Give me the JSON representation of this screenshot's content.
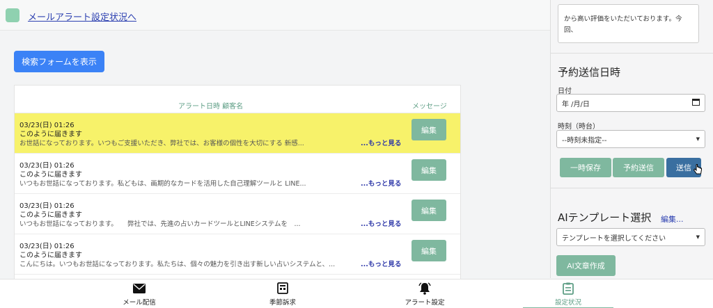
{
  "header": {
    "link_text": "メールアラート設定状況へ"
  },
  "search": {
    "button_label": "検索フォームを表示"
  },
  "table": {
    "col_alert": "アラート日時 顧客名",
    "col_message": "メッセージ",
    "more_label": "...もっと見る",
    "edit_label": "編集",
    "rows": [
      {
        "datetime": "03/23(日) 01:26",
        "subject": "このように届きます",
        "preview": "お世話になっております。いつもご支援いただき、弊社では、お客様の個性を大切にする 新感..."
      },
      {
        "datetime": "03/23(日) 01:26",
        "subject": "このように届きます",
        "preview": "いつもお世話になっております。私どもは、画期的なカードを活用した自己理解ツールと LINE..."
      },
      {
        "datetime": "03/23(日) 01:26",
        "subject": "このように届きます",
        "preview": "いつもお世話になっております。　　弊社では、先進の占いカードツールとLINEシステムを　..."
      },
      {
        "datetime": "03/23(日) 01:26",
        "subject": "このように届きます",
        "preview": "こんにちは。いつもお世話になっております。私たちは、個々の魅力を引き出す新しい占いシステムと、..."
      }
    ]
  },
  "panel": {
    "textarea_text": "から高い評価をいただいております。今回、",
    "schedule_title": "予約送信日時",
    "date_label": "日付",
    "date_placeholder": "年 /月/日",
    "time_label": "時刻（時台）",
    "time_value": "--時刻未指定--",
    "save_label": "一時保存",
    "reserve_label": "予約送信",
    "send_label": "送信",
    "ai_title": "AIテンプレート選択",
    "ai_edit": "編集...",
    "template_value": "テンプレートを選択してください",
    "ai_create_label": "AI文章作成"
  },
  "tabs": [
    {
      "label": "メール配信",
      "icon": "envelope-icon"
    },
    {
      "label": "季節訴求",
      "icon": "newspaper-icon"
    },
    {
      "label": "アラート設定",
      "icon": "bell-icon"
    },
    {
      "label": "設定状況",
      "icon": "clipboard-icon"
    }
  ],
  "colors": {
    "accent": "#7fb89f",
    "highlight": "#f7f26a",
    "primary": "#3b82f6",
    "send": "#3a6fa0"
  }
}
